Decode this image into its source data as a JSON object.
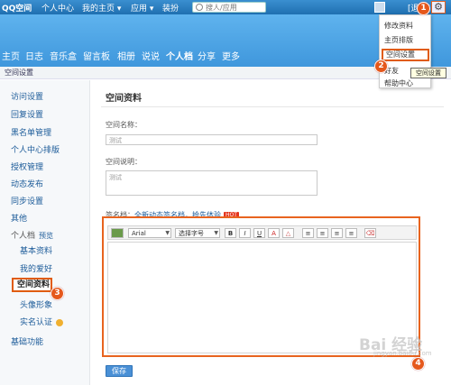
{
  "topbar": {
    "logo": "QQ空间",
    "personal_center": "个人中心",
    "my_home": "我的主页 ▾",
    "apps": "应用 ▾",
    "decorate": "装扮",
    "search_placeholder": "搜人/应用",
    "logout": "[退出]"
  },
  "nav": {
    "items": [
      "主页",
      "日志",
      "音乐盒",
      "留言板",
      "相册",
      "说说",
      "个人档",
      "分享",
      "更多"
    ]
  },
  "breadcrumb": "空间设置",
  "sidebar": {
    "access": "访问设置",
    "reply": "回复设置",
    "blacklist": "黑名单管理",
    "personal_center_sort": "个人中心排版",
    "auth": "授权管理",
    "dynamic": "动态发布",
    "sync": "同步设置",
    "other": "其他",
    "profile_group": "个人档",
    "preview": "预览",
    "basic_info": "基本资料",
    "hobbies": "我的爱好",
    "space_info": "空间资料",
    "avatar": "头像形象",
    "real_name": "实名认证",
    "basic_features": "基础功能"
  },
  "main": {
    "title": "空间资料",
    "name_label": "空间名称：",
    "name_value": "测试",
    "desc_label": "空间说明：",
    "desc_value": "测试",
    "signature_label": "签名档：",
    "signature_link": "全新动态签名档，抢先体验",
    "hot": "HOT",
    "save": "保存"
  },
  "editor": {
    "font": "Arial",
    "font_size": "选择字号",
    "bold": "B",
    "italic": "I",
    "underline": "U",
    "font_color": "A"
  },
  "menu": {
    "items": [
      "修改资料",
      "主页排版",
      "空间设置",
      "好友",
      "帮助中心"
    ],
    "tooltip": "空间设置"
  },
  "steps": [
    "1",
    "2",
    "3",
    "4"
  ],
  "watermark": "Bai 经验",
  "watermark_sub": "jingyan.baidu.com"
}
